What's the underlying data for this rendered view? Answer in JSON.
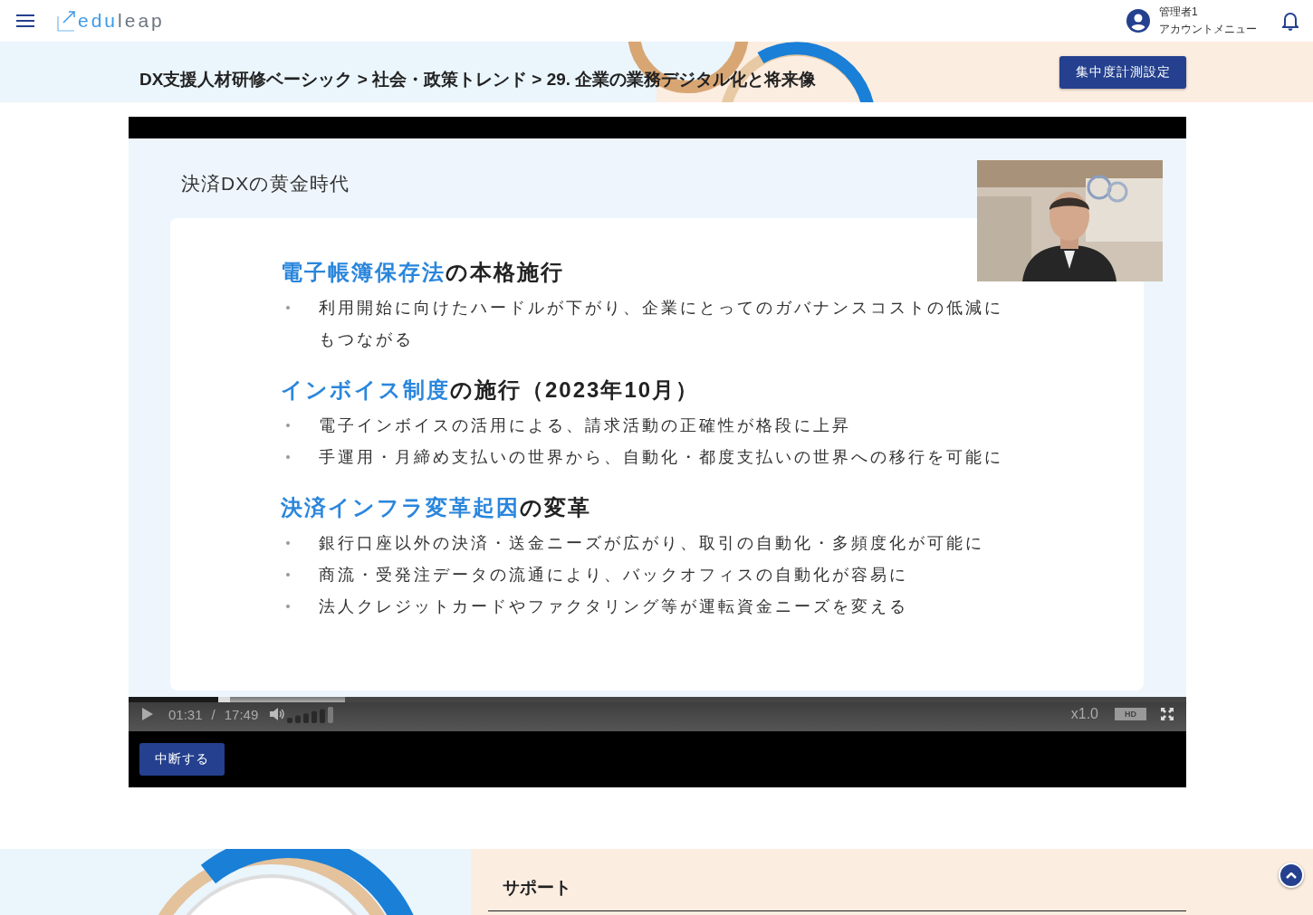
{
  "header": {
    "logo": [
      "edu",
      "leap"
    ],
    "user_name": "管理者1",
    "account_menu": "アカウントメニュー"
  },
  "banner": {
    "breadcrumb": "DX支援人材研修ベーシック > 社会・政策トレンド > 29. 企業の業務デジタル化と将来像",
    "button": "集中度計測設定"
  },
  "video": {
    "slide": {
      "title": "決済DXの黄金時代",
      "sections": [
        {
          "highlight": "電子帳簿保存法",
          "rest": "の本格施行",
          "bullets": [
            "利用開始に向けたハードルが下がり、企業にとってのガバナンスコストの低減にもつながる"
          ]
        },
        {
          "highlight": "インボイス制度",
          "rest": "の施行（2023年10月）",
          "bullets": [
            "電子インボイスの活用による、請求活動の正確性が格段に上昇",
            "手運用・月締め支払いの世界から、自動化・都度支払いの世界への移行を可能に"
          ]
        },
        {
          "highlight": "決済インフラ変革起因",
          "rest": "の変革",
          "bullets": [
            "銀行口座以外の決済・送金ニーズが広がり、取引の自動化・多頻度化が可能に",
            "商流・受発注データの流通により、バックオフィスの自動化が容易に",
            "法人クレジットカードやファクタリング等が運転資金ニーズを変える"
          ]
        }
      ]
    },
    "progress": {
      "level": 0.085
    },
    "buffer": {
      "level": 0.205
    },
    "current_time": "01:31",
    "separator": "/",
    "duration": "17:49",
    "speed": "x1.0",
    "quality": "HD",
    "stop_button": "中断する"
  },
  "footer": {
    "heading": "サポート"
  }
}
